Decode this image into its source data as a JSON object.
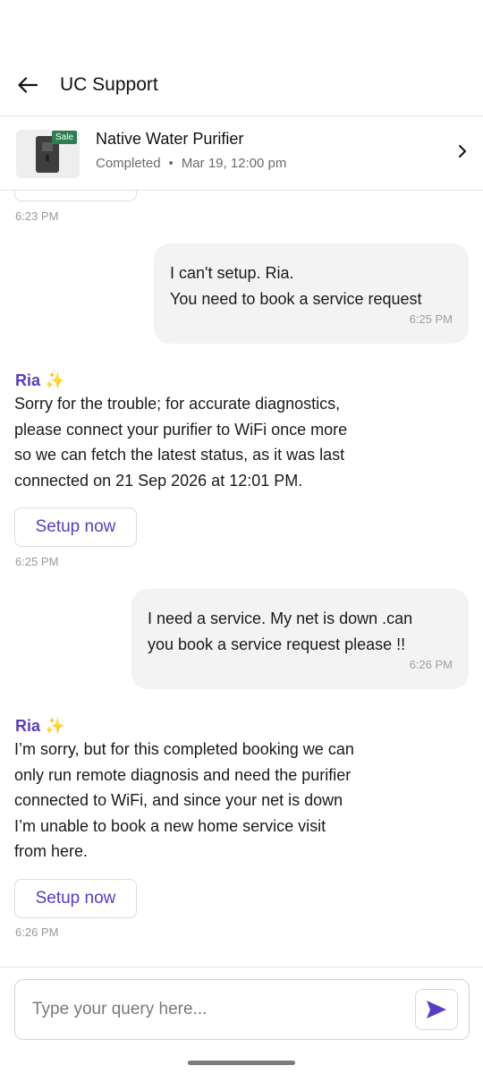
{
  "header": {
    "title": "UC Support",
    "back_icon": "arrow-left-icon"
  },
  "order": {
    "name": "Native Water Purifier",
    "status": "Completed",
    "separator": "•",
    "datetime": "Mar 19, 12:00 pm",
    "badge": "Sale",
    "chevron_icon": "chevron-right-icon"
  },
  "messages": [
    {
      "type": "bot_timestamp",
      "time": "6:23 PM"
    },
    {
      "type": "user",
      "lines": [
        "I can't setup. Ria.",
        "You need to book a service request"
      ],
      "time": "6:25 PM"
    },
    {
      "type": "bot",
      "name": "Ria",
      "emoji": "✨",
      "lines": [
        "Sorry for the trouble; for accurate diagnostics,",
        "please connect your purifier to WiFi once more",
        "so we can fetch the latest status, as it was last",
        "connected on 21 Sep 2026 at 12:01 PM."
      ],
      "button": "Setup now",
      "time": "6:25 PM"
    },
    {
      "type": "user",
      "lines": [
        "I need a service. My net is down .can",
        "you book a service request please !!"
      ],
      "time": "6:26 PM"
    },
    {
      "type": "bot",
      "name": "Ria",
      "emoji": "✨",
      "lines": [
        "I’m sorry, but for this completed booking we can",
        "only run remote diagnosis and need the purifier",
        "connected to WiFi, and since your net is down",
        "I’m unable to book a new home service visit",
        "from here."
      ],
      "button": "Setup now",
      "time": "6:26 PM"
    }
  ],
  "composer": {
    "placeholder": "Type your query here...",
    "value": "",
    "send_icon": "send-icon"
  },
  "colors": {
    "accent": "#5b3cc4",
    "bubble": "#f3f3f3",
    "sale_badge": "#2e7d4f"
  }
}
